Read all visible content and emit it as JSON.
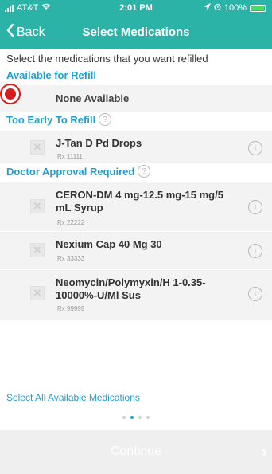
{
  "status": {
    "carrier": "AT&T",
    "time": "2:01 PM",
    "battery": "100%"
  },
  "nav": {
    "back": "Back",
    "title": "Select Medications"
  },
  "intro": "Select the medications that you want refilled",
  "sections": {
    "available": {
      "title": "Available for Refill",
      "empty": "None Available"
    },
    "too_early": {
      "title": "Too Early To Refill"
    },
    "doctor": {
      "title": "Doctor Approval Required"
    }
  },
  "meds": [
    {
      "name": "J-Tan D Pd Drops",
      "rx": "Rx 11111"
    },
    {
      "name": "CERON-DM 4 mg-12.5 mg-15 mg/5 mL Syrup",
      "rx": "Rx 22222"
    },
    {
      "name": "Nexium Cap  40 Mg  30",
      "rx": "Rx 33333"
    },
    {
      "name": "Neomycin/Polymyxin/H 1-0.35-10000%-U/Ml Sus",
      "rx": "Rx 99999"
    }
  ],
  "select_all": "Select All Available Medications",
  "continue": "Continue",
  "colors": {
    "accent": "#2bb3a8",
    "link": "#1e9fd6"
  }
}
